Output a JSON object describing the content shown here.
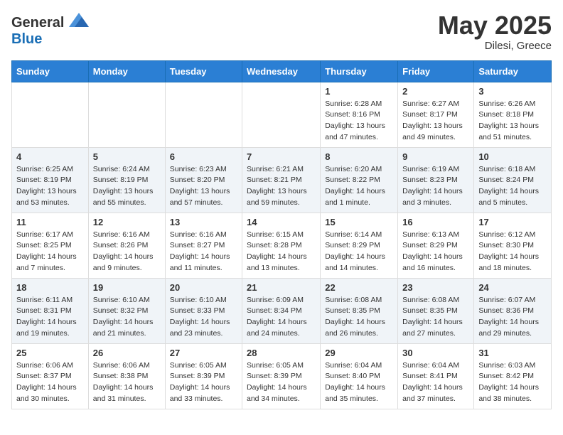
{
  "logo": {
    "text_general": "General",
    "text_blue": "Blue"
  },
  "title": {
    "month_year": "May 2025",
    "location": "Dilesi, Greece"
  },
  "days_of_week": [
    "Sunday",
    "Monday",
    "Tuesday",
    "Wednesday",
    "Thursday",
    "Friday",
    "Saturday"
  ],
  "weeks": [
    [
      {
        "day": "",
        "info": ""
      },
      {
        "day": "",
        "info": ""
      },
      {
        "day": "",
        "info": ""
      },
      {
        "day": "",
        "info": ""
      },
      {
        "day": "1",
        "info": "Sunrise: 6:28 AM\nSunset: 8:16 PM\nDaylight: 13 hours\nand 47 minutes."
      },
      {
        "day": "2",
        "info": "Sunrise: 6:27 AM\nSunset: 8:17 PM\nDaylight: 13 hours\nand 49 minutes."
      },
      {
        "day": "3",
        "info": "Sunrise: 6:26 AM\nSunset: 8:18 PM\nDaylight: 13 hours\nand 51 minutes."
      }
    ],
    [
      {
        "day": "4",
        "info": "Sunrise: 6:25 AM\nSunset: 8:19 PM\nDaylight: 13 hours\nand 53 minutes."
      },
      {
        "day": "5",
        "info": "Sunrise: 6:24 AM\nSunset: 8:19 PM\nDaylight: 13 hours\nand 55 minutes."
      },
      {
        "day": "6",
        "info": "Sunrise: 6:23 AM\nSunset: 8:20 PM\nDaylight: 13 hours\nand 57 minutes."
      },
      {
        "day": "7",
        "info": "Sunrise: 6:21 AM\nSunset: 8:21 PM\nDaylight: 13 hours\nand 59 minutes."
      },
      {
        "day": "8",
        "info": "Sunrise: 6:20 AM\nSunset: 8:22 PM\nDaylight: 14 hours\nand 1 minute."
      },
      {
        "day": "9",
        "info": "Sunrise: 6:19 AM\nSunset: 8:23 PM\nDaylight: 14 hours\nand 3 minutes."
      },
      {
        "day": "10",
        "info": "Sunrise: 6:18 AM\nSunset: 8:24 PM\nDaylight: 14 hours\nand 5 minutes."
      }
    ],
    [
      {
        "day": "11",
        "info": "Sunrise: 6:17 AM\nSunset: 8:25 PM\nDaylight: 14 hours\nand 7 minutes."
      },
      {
        "day": "12",
        "info": "Sunrise: 6:16 AM\nSunset: 8:26 PM\nDaylight: 14 hours\nand 9 minutes."
      },
      {
        "day": "13",
        "info": "Sunrise: 6:16 AM\nSunset: 8:27 PM\nDaylight: 14 hours\nand 11 minutes."
      },
      {
        "day": "14",
        "info": "Sunrise: 6:15 AM\nSunset: 8:28 PM\nDaylight: 14 hours\nand 13 minutes."
      },
      {
        "day": "15",
        "info": "Sunrise: 6:14 AM\nSunset: 8:29 PM\nDaylight: 14 hours\nand 14 minutes."
      },
      {
        "day": "16",
        "info": "Sunrise: 6:13 AM\nSunset: 8:29 PM\nDaylight: 14 hours\nand 16 minutes."
      },
      {
        "day": "17",
        "info": "Sunrise: 6:12 AM\nSunset: 8:30 PM\nDaylight: 14 hours\nand 18 minutes."
      }
    ],
    [
      {
        "day": "18",
        "info": "Sunrise: 6:11 AM\nSunset: 8:31 PM\nDaylight: 14 hours\nand 19 minutes."
      },
      {
        "day": "19",
        "info": "Sunrise: 6:10 AM\nSunset: 8:32 PM\nDaylight: 14 hours\nand 21 minutes."
      },
      {
        "day": "20",
        "info": "Sunrise: 6:10 AM\nSunset: 8:33 PM\nDaylight: 14 hours\nand 23 minutes."
      },
      {
        "day": "21",
        "info": "Sunrise: 6:09 AM\nSunset: 8:34 PM\nDaylight: 14 hours\nand 24 minutes."
      },
      {
        "day": "22",
        "info": "Sunrise: 6:08 AM\nSunset: 8:35 PM\nDaylight: 14 hours\nand 26 minutes."
      },
      {
        "day": "23",
        "info": "Sunrise: 6:08 AM\nSunset: 8:35 PM\nDaylight: 14 hours\nand 27 minutes."
      },
      {
        "day": "24",
        "info": "Sunrise: 6:07 AM\nSunset: 8:36 PM\nDaylight: 14 hours\nand 29 minutes."
      }
    ],
    [
      {
        "day": "25",
        "info": "Sunrise: 6:06 AM\nSunset: 8:37 PM\nDaylight: 14 hours\nand 30 minutes."
      },
      {
        "day": "26",
        "info": "Sunrise: 6:06 AM\nSunset: 8:38 PM\nDaylight: 14 hours\nand 31 minutes."
      },
      {
        "day": "27",
        "info": "Sunrise: 6:05 AM\nSunset: 8:39 PM\nDaylight: 14 hours\nand 33 minutes."
      },
      {
        "day": "28",
        "info": "Sunrise: 6:05 AM\nSunset: 8:39 PM\nDaylight: 14 hours\nand 34 minutes."
      },
      {
        "day": "29",
        "info": "Sunrise: 6:04 AM\nSunset: 8:40 PM\nDaylight: 14 hours\nand 35 minutes."
      },
      {
        "day": "30",
        "info": "Sunrise: 6:04 AM\nSunset: 8:41 PM\nDaylight: 14 hours\nand 37 minutes."
      },
      {
        "day": "31",
        "info": "Sunrise: 6:03 AM\nSunset: 8:42 PM\nDaylight: 14 hours\nand 38 minutes."
      }
    ]
  ]
}
